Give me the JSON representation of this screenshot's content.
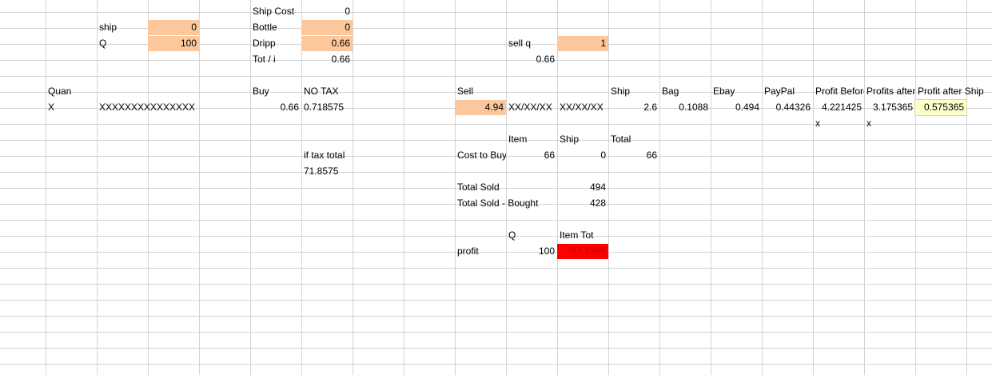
{
  "cells": {
    "ship_cost_label": "Ship Cost",
    "ship_cost_value": "0",
    "ship_label": "ship",
    "ship_value": "0",
    "bottle_label": "Bottle",
    "bottle_value": "0",
    "q_label": "Q",
    "q_value": "100",
    "dripp_label": "Dripp",
    "dripp_value": "0.66",
    "sellq_label": "sell q",
    "sellq_value": "1",
    "tot_i_label": "Tot / i",
    "tot_i_value": "0.66",
    "sellq_result": "0.66",
    "quan_label": "Quan",
    "buy_label": "Buy",
    "notax_label": "NO TAX",
    "sell_label": "Sell",
    "shiph_label": "Ship",
    "bag_label": "Bag",
    "ebay_label": "Ebay",
    "paypal_label": "PayPal",
    "profit_before_label": "Profit Before Ship",
    "profits_after_label": "Profits after fees",
    "profit_after_ship_label": "Profit after Ship",
    "row_x": "X",
    "row_xxx": "XXXXXXXXXXXXXXX",
    "buy_value": "0.66",
    "notax_value": "0.718575",
    "sell_value": "4.94",
    "date1": "XX/XX/XX",
    "date2": "XX/XX/XX",
    "ship_val": "2.6",
    "bag_val": "0.1088",
    "ebay_val": "0.494",
    "paypal_val": "0.44326",
    "profit_before_val": "4.221425",
    "profits_after_val": "3.175365",
    "profit_after_ship_val": "0.575365",
    "x_mark1": "x",
    "x_mark2": "x",
    "item_label": "Item",
    "ship2_label": "Ship",
    "total_label": "Total",
    "iftax_label": "if tax total",
    "cost_to_buy_label": "Cost to Buy",
    "cost_item": "66",
    "cost_ship": "0",
    "cost_total": "66",
    "iftax_value": "71.8575",
    "total_sold_label": "Total Sold",
    "total_sold_value": "494",
    "sold_bought_label": "Total Sold - Bought",
    "sold_bought_value": "428",
    "q2_label": "Q",
    "item_tot_label": "Item Tot",
    "profit_label": "profit",
    "profit_q": "100",
    "profit_value": "57.5365"
  },
  "colors": {
    "input_fill": "#fcc89b",
    "highlight_fill": "#ffffcc",
    "alert_fill": "#ff0000",
    "alert_text": "#c00000",
    "gridline": "#d4d4d4"
  }
}
